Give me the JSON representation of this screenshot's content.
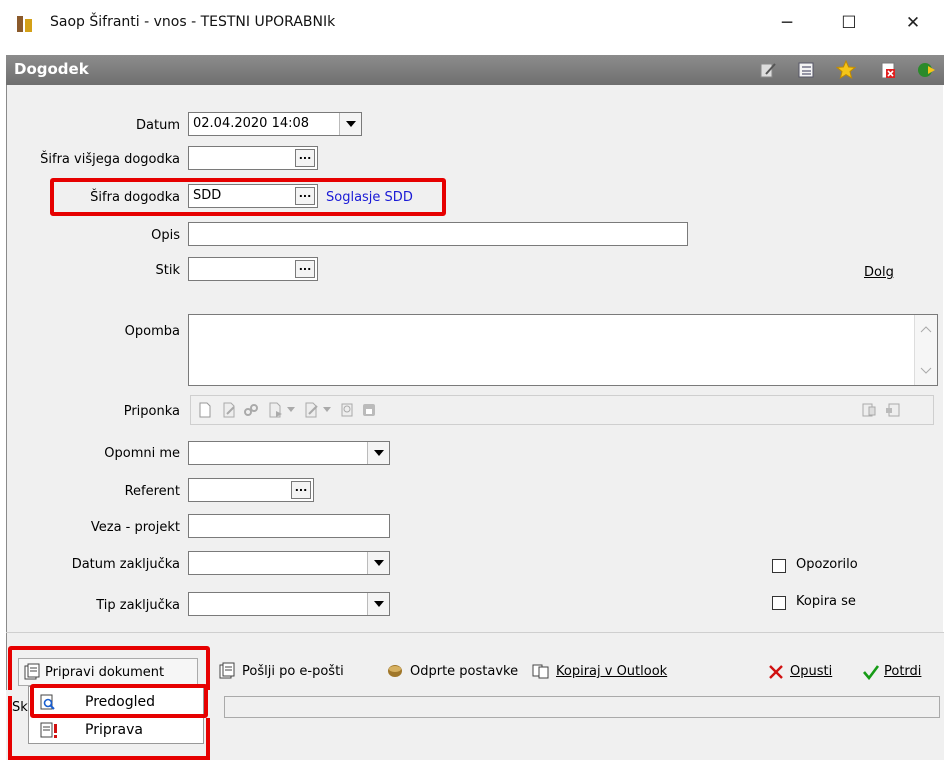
{
  "window": {
    "title": "Saop Šifranti - vnos - TESTNI UPORABNIk"
  },
  "panel": {
    "title": "Dogodek",
    "header_icons": [
      "edit-icon",
      "list-icon",
      "star-icon",
      "delete-icon",
      "exit-icon"
    ]
  },
  "form": {
    "datum": {
      "label": "Datum",
      "value": "02.04.2020 14:08"
    },
    "visjega": {
      "label": "Šifra višjega dogodka",
      "value": ""
    },
    "sifra": {
      "label": "Šifra dogodka",
      "value": "SDD",
      "link": "Soglasje SDD"
    },
    "opis": {
      "label": "Opis",
      "value": ""
    },
    "stik": {
      "label": "Stik",
      "value": ""
    },
    "dolg": "Dolg",
    "opomba": {
      "label": "Opomba",
      "value": ""
    },
    "priponka": {
      "label": "Priponka"
    },
    "opomni": {
      "label": "Opomni me",
      "value": ""
    },
    "referent": {
      "label": "Referent",
      "value": ""
    },
    "veza": {
      "label": "Veza - projekt",
      "value": ""
    },
    "datum_zakljucka": {
      "label": "Datum zaključka",
      "value": ""
    },
    "tip_zakljucka": {
      "label": "Tip zaključka",
      "value": ""
    },
    "opozorilo": {
      "label": "Opozorilo",
      "checked": false
    },
    "kopira": {
      "label": "Kopira se",
      "checked": false
    }
  },
  "bottom": {
    "pripravi": "Pripravi dokument",
    "poslji": "Pošlji po e-pošti",
    "odprte": "Odprte postavke",
    "kopiraj": "Kopiraj v Outlook",
    "opusti": "Opusti",
    "potrdi": "Potrdi",
    "status_prefix": "Sk"
  },
  "menu": {
    "items": [
      "Predogled",
      "Priprava"
    ]
  },
  "colors": {
    "highlight": "#e60000",
    "link": "#1a1ad6",
    "panel_header": "#7a7a7a"
  }
}
